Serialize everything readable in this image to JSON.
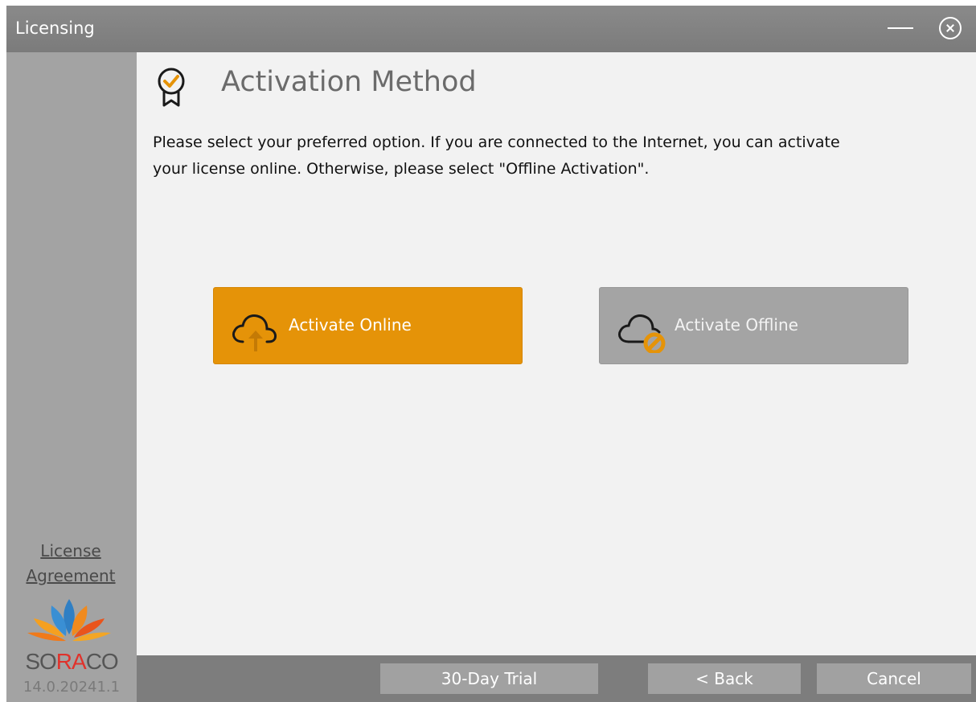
{
  "window": {
    "title": "Licensing",
    "accent_color": "#e59308"
  },
  "sidebar": {
    "license_link": "License Agreement",
    "logo_text_1": "SO",
    "logo_text_2": "RA",
    "logo_text_3": "CO",
    "version": "14.0.20241.1"
  },
  "main": {
    "title": "Activation Method",
    "description": "Please select your preferred option. If you are connected to the Internet, you can activate your license online. Otherwise, please select \"Offline Activation\".",
    "online_label": "Activate Online",
    "offline_label": "Activate Offline"
  },
  "footer": {
    "trial_label": "30-Day Trial",
    "back_label": "< Back",
    "cancel_label": "Cancel"
  },
  "icons": {
    "minimize": "minimize-icon",
    "close": "close-icon",
    "award": "award-check-icon",
    "online": "cloud-upload-icon",
    "offline": "cloud-blocked-icon"
  }
}
